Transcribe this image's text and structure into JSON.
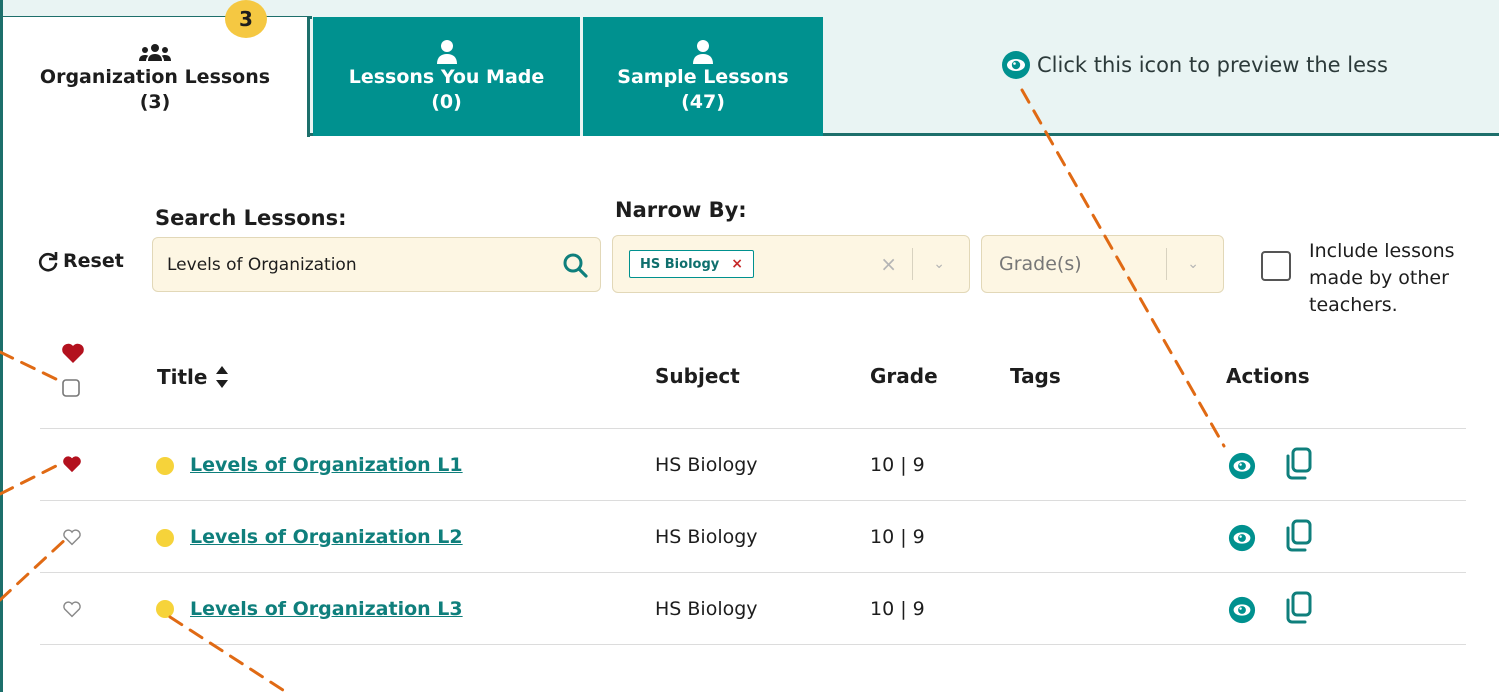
{
  "tabs": [
    {
      "label": "Organization Lessons",
      "count": "(3)",
      "active": true
    },
    {
      "label": "Lessons You Made",
      "count": "(0)",
      "active": false
    },
    {
      "label": "Sample Lessons",
      "count": "(47)",
      "active": false
    }
  ],
  "tab_badge": "3",
  "hint": {
    "text": "Click this icon to preview the less"
  },
  "filters": {
    "search_label": "Search Lessons:",
    "narrow_label": "Narrow By:",
    "reset_label": "Reset",
    "search_value": "Levels of Organization",
    "subject_chip": "HS Biology",
    "chip_remove": "×",
    "clear_glyph": "×",
    "caret_glyph": "⌄",
    "grade_placeholder": "Grade(s)",
    "include_label_1": "Include lessons",
    "include_label_2": "made by other",
    "include_label_3": "teachers."
  },
  "table": {
    "headers": {
      "title": "Title",
      "subject": "Subject",
      "grade": "Grade",
      "tags": "Tags",
      "actions": "Actions"
    },
    "rows": [
      {
        "title": "Levels of Organization L1",
        "subject": "HS Biology",
        "grade": "10 | 9",
        "favorite": true
      },
      {
        "title": "Levels of Organization L2",
        "subject": "HS Biology",
        "grade": "10 | 9",
        "favorite": false
      },
      {
        "title": "Levels of Organization L3",
        "subject": "HS Biology",
        "grade": "10 | 9",
        "favorite": false
      }
    ]
  },
  "colors": {
    "teal": "#00918f",
    "dark_teal": "#1d6f6b",
    "heart_red": "#b3111e",
    "dot_yellow": "#f6d33a",
    "dash_orange": "#e06a14"
  }
}
